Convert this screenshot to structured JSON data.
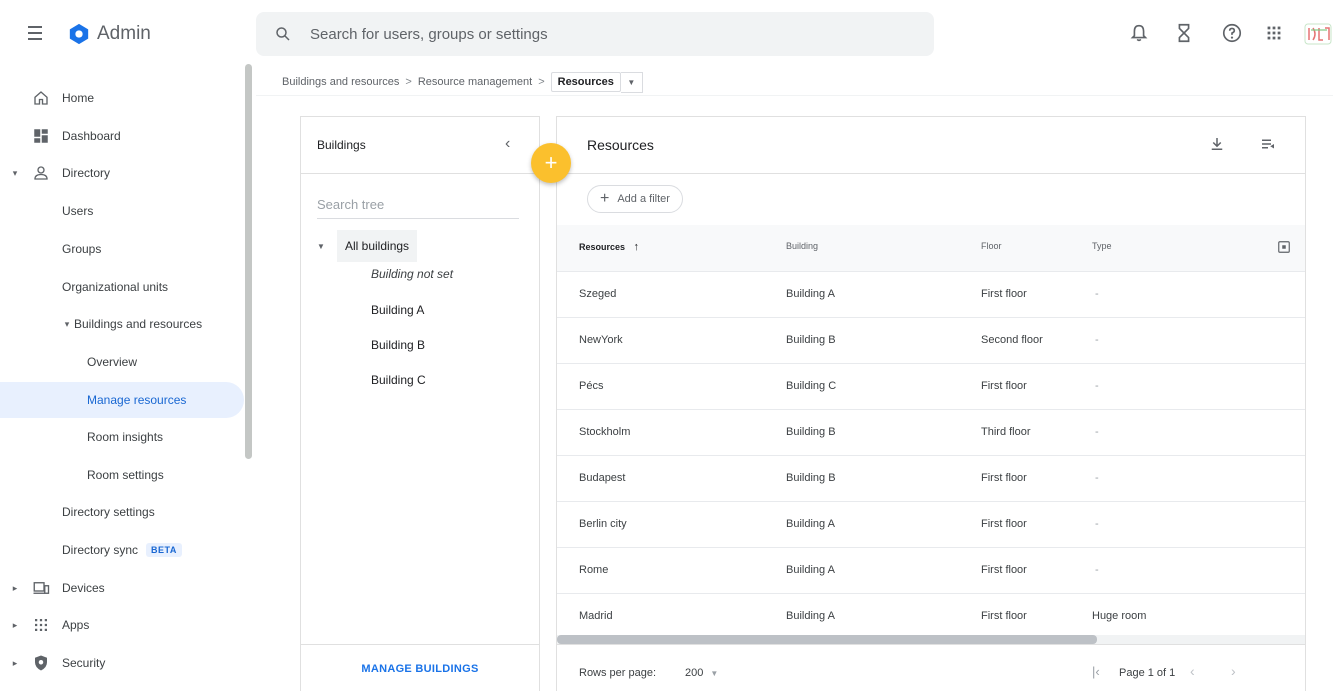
{
  "app": {
    "title": "Admin"
  },
  "search": {
    "placeholder": "Search for users, groups or settings"
  },
  "topbar_icons": [
    "bell-icon",
    "hourglass-icon",
    "help-icon",
    "apps-grid-icon"
  ],
  "sidebar": {
    "home": "Home",
    "dashboard": "Dashboard",
    "directory": "Directory",
    "users": "Users",
    "groups": "Groups",
    "org_units": "Organizational units",
    "buildings_resources": "Buildings and resources",
    "overview": "Overview",
    "manage_resources": "Manage resources",
    "room_insights": "Room insights",
    "room_settings": "Room settings",
    "directory_settings": "Directory settings",
    "directory_sync": "Directory sync",
    "beta": "BETA",
    "devices": "Devices",
    "apps": "Apps",
    "security": "Security"
  },
  "breadcrumb": {
    "crumb1": "Buildings and resources",
    "crumb2": "Resource management",
    "current": "Resources",
    "sep": ">"
  },
  "buildings_panel": {
    "title": "Buildings",
    "search_placeholder": "Search tree",
    "root": "All buildings",
    "leaves": [
      "Building not set",
      "Building A",
      "Building B",
      "Building C"
    ],
    "footer_button": "MANAGE BUILDINGS"
  },
  "fab": {
    "label": "+"
  },
  "resources_panel": {
    "title": "Resources",
    "filter_label": "Add a filter",
    "columns": [
      "Resources",
      "Building",
      "Floor",
      "Type"
    ],
    "sort_indicator": "↑",
    "rows": [
      [
        "Szeged",
        "Building A",
        "First floor",
        "-"
      ],
      [
        "NewYork",
        "Building B",
        "Second floor",
        "-"
      ],
      [
        "Pécs",
        "Building C",
        "First floor",
        "-"
      ],
      [
        "Stockholm",
        "Building B",
        "Third floor",
        "-"
      ],
      [
        "Budapest",
        "Building B",
        "First floor",
        "-"
      ],
      [
        "Berlin city",
        "Building A",
        "First floor",
        "-"
      ],
      [
        "Rome",
        "Building A",
        "First floor",
        "-"
      ],
      [
        "Madrid",
        "Building A",
        "First floor",
        "Huge room"
      ]
    ],
    "footer": {
      "rows_per_page_label": "Rows per page:",
      "rows_per_page_value": "200",
      "page_text": "Page 1 of 1"
    }
  },
  "colors": {
    "accent": "#1a73e8",
    "fab": "#fbc02d",
    "active_bg": "#e8f0fe"
  }
}
